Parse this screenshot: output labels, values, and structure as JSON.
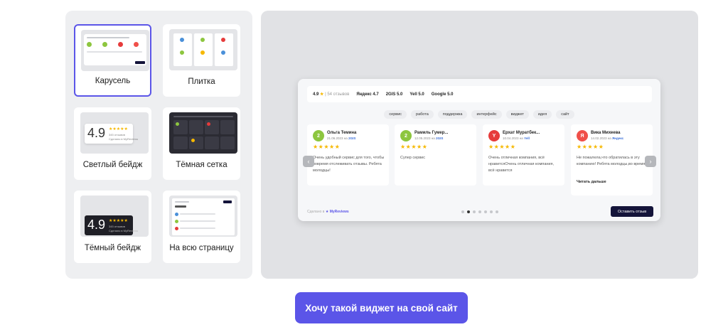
{
  "layouts": [
    {
      "label": "Карусель",
      "selected": true
    },
    {
      "label": "Плитка",
      "selected": false
    },
    {
      "label": "Светлый бейдж",
      "selected": false
    },
    {
      "label": "Тёмная сетка",
      "selected": false
    },
    {
      "label": "Тёмный бейдж",
      "selected": false
    },
    {
      "label": "На всю страницу",
      "selected": false
    }
  ],
  "badge": {
    "score": "4.9",
    "stars": "★★★★★",
    "reviews": "345 отзывов",
    "credit": "Сделано в MyReviews"
  },
  "preview": {
    "rating": {
      "score": "4.9",
      "star": "★",
      "count": "54 отзывов"
    },
    "sources": [
      {
        "name": "Яндекс",
        "score": "4.7"
      },
      {
        "name": "2GIS",
        "score": "5.0"
      },
      {
        "name": "Yell",
        "score": "5.0"
      },
      {
        "name": "Google",
        "score": "5.0"
      }
    ],
    "tags": [
      "сервис",
      "работа",
      "поддержка",
      "интерфейс",
      "виджет",
      "идея",
      "сайт"
    ],
    "reviews": [
      {
        "initial": "2",
        "color": "#8dc63f",
        "name": "Ольга Темина",
        "date": "21.06.2023",
        "via": "на",
        "source": "2GIS",
        "stars": "★★★★★",
        "text": "Очень удобный сервис для того, чтобы вовремя отслеживать отзывы. Ребята молодцы!",
        "more": ""
      },
      {
        "initial": "2",
        "color": "#8dc63f",
        "name": "Рамиль Гумер...",
        "date": "12.05.2023",
        "via": "на",
        "source": "2GIS",
        "stars": "★★★★★",
        "text": "Супер сервис",
        "more": ""
      },
      {
        "initial": "Y",
        "color": "#e63b3b",
        "name": "Ерхат Муратбек...",
        "date": "10.04.2023",
        "via": "на",
        "source": "Yell",
        "stars": "★★★★★",
        "text": "Очень отличная компания, всё нравитсяОчень отличная компания, всё нравится",
        "more": ""
      },
      {
        "initial": "Я",
        "color": "#f0504a",
        "name": "Вика Михеева",
        "date": "14.02.2023",
        "via": "на",
        "source": "Яндекс",
        "stars": "★★★★★",
        "text": "Не пожалела,что обратилась в эту компанию! Ребята молодцы,во время...",
        "more": "Читать дальше"
      }
    ],
    "prev_icon": "‹",
    "next_icon": "›",
    "credit_prefix": "Сделано в",
    "credit_brand": "MyReviews",
    "leave_review": "Оставить отзыв",
    "pagination": {
      "current": 2,
      "total": 7
    }
  },
  "cta": "Хочу такой виджет на свой сайт"
}
